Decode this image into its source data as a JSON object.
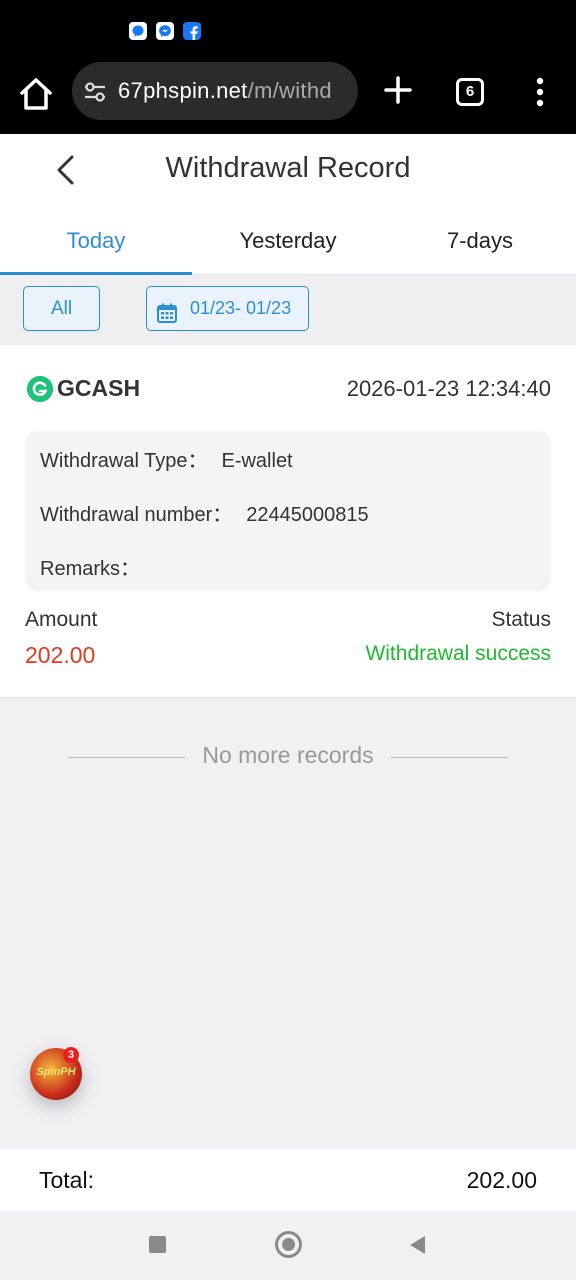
{
  "status_bar": {
    "notification_icons": [
      "messenger-chat-icon",
      "messenger-icon",
      "facebook-icon"
    ]
  },
  "browser": {
    "url_host": "67phspin.net",
    "url_path": "/m/withd",
    "tab_count": "6"
  },
  "header": {
    "title": "Withdrawal Record"
  },
  "tabs": [
    {
      "label": "Today",
      "active": true
    },
    {
      "label": "Yesterday",
      "active": false
    },
    {
      "label": "7-days",
      "active": false
    }
  ],
  "filters": {
    "all_label": "All",
    "date_range": "01/23- 01/23"
  },
  "record": {
    "method": "GCASH",
    "datetime": "2026-01-23 12:34:40",
    "withdrawal_type_label": "Withdrawal Type：",
    "withdrawal_type_value": "E-wallet",
    "withdrawal_number_label": "Withdrawal number：",
    "withdrawal_number_value": "22445000815",
    "remarks_label": "Remarks：",
    "remarks_value": "",
    "amount_label": "Amount",
    "amount_value": "202.00",
    "status_label": "Status",
    "status_value": "Withdrawal success"
  },
  "list_footer": {
    "no_more_text": "No more records"
  },
  "floating_widget": {
    "logo_text": "SpinPH",
    "badge_count": "3"
  },
  "total": {
    "label": "Total:",
    "value": "202.00"
  },
  "colors": {
    "accent": "#2c8fd6",
    "amount": "#e03b1e",
    "success": "#1db92f",
    "gcash": "#1ec27a"
  }
}
